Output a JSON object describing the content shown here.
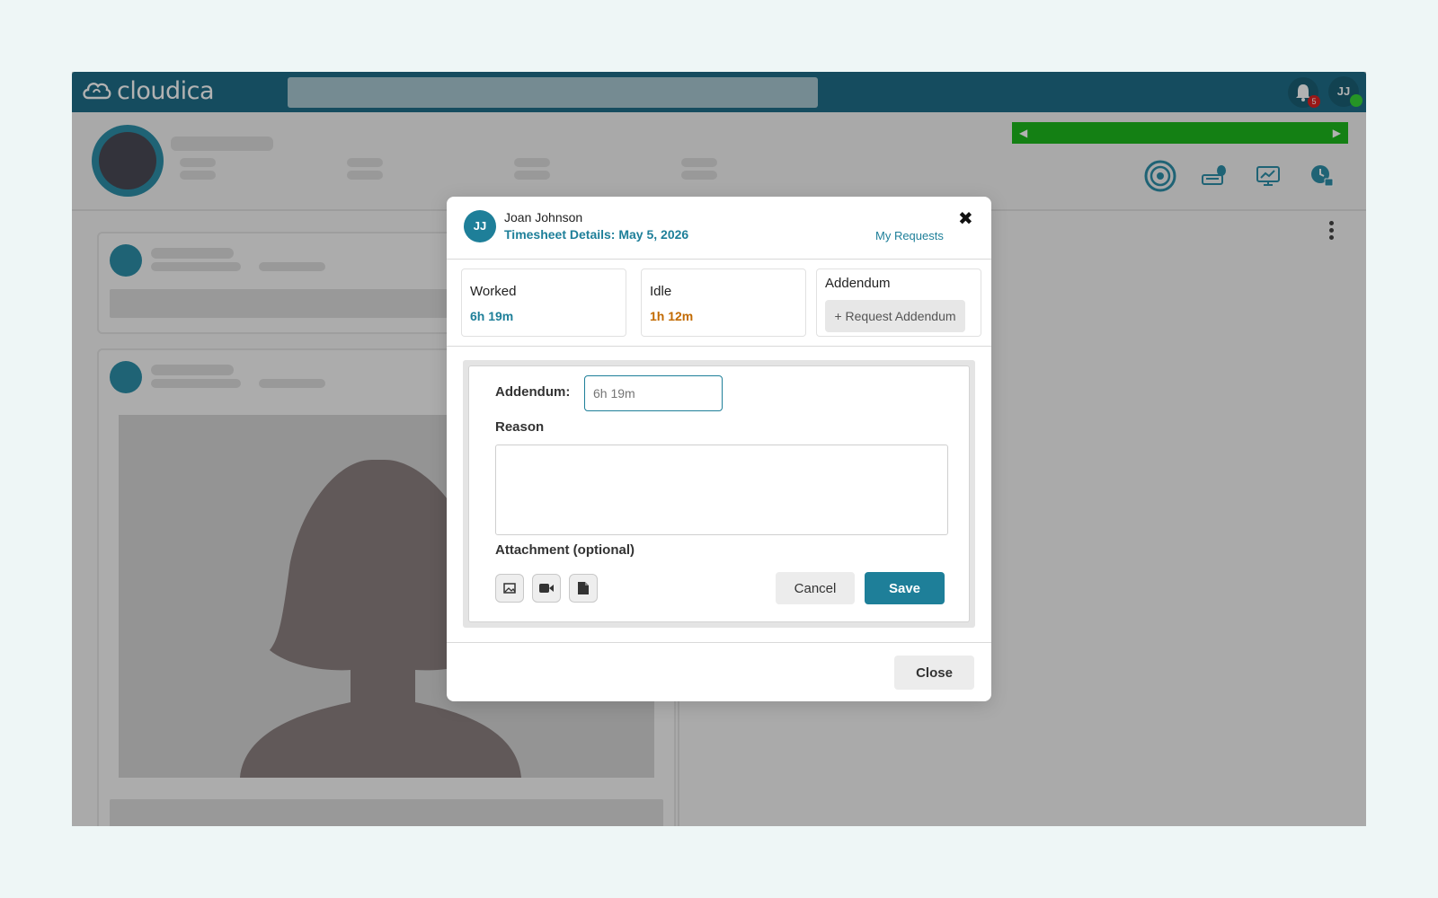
{
  "app": {
    "logo_text": "cloudica",
    "notifications_count": "5",
    "user_initials": "JJ"
  },
  "modal": {
    "avatar_initials": "JJ",
    "employee_name": "Joan Johnson",
    "title": "Timesheet Details: May 5, 2026",
    "my_requests_link": "My Requests",
    "stats": {
      "worked_label": "Worked",
      "worked_value": "6h 19m",
      "idle_label": "Idle",
      "idle_value": "1h 12m",
      "addendum_label": "Addendum",
      "request_addendum_label": "+ Request Addendum"
    },
    "form": {
      "addendum_label": "Addendum:",
      "addendum_placeholder": "6h 19m",
      "reason_label": "Reason",
      "reason_value": "",
      "attachment_label": "Attachment (optional)",
      "cancel_label": "Cancel",
      "save_label": "Save"
    },
    "close_label": "Close"
  },
  "colors": {
    "brand": "#1f6e88",
    "accent": "#1e7f99",
    "idle": "#c26a00",
    "online": "#35d435",
    "badge": "#dd2222",
    "timeline": "#1db81d"
  },
  "icons": [
    "cloud-logo-icon",
    "bell-icon",
    "broadcast-icon",
    "keyboard-mouse-icon",
    "monitor-chart-icon",
    "clock-lock-icon",
    "kebab-menu-icon",
    "close-icon",
    "image-icon",
    "video-icon",
    "document-icon",
    "chevron-left-icon",
    "chevron-right-icon"
  ]
}
